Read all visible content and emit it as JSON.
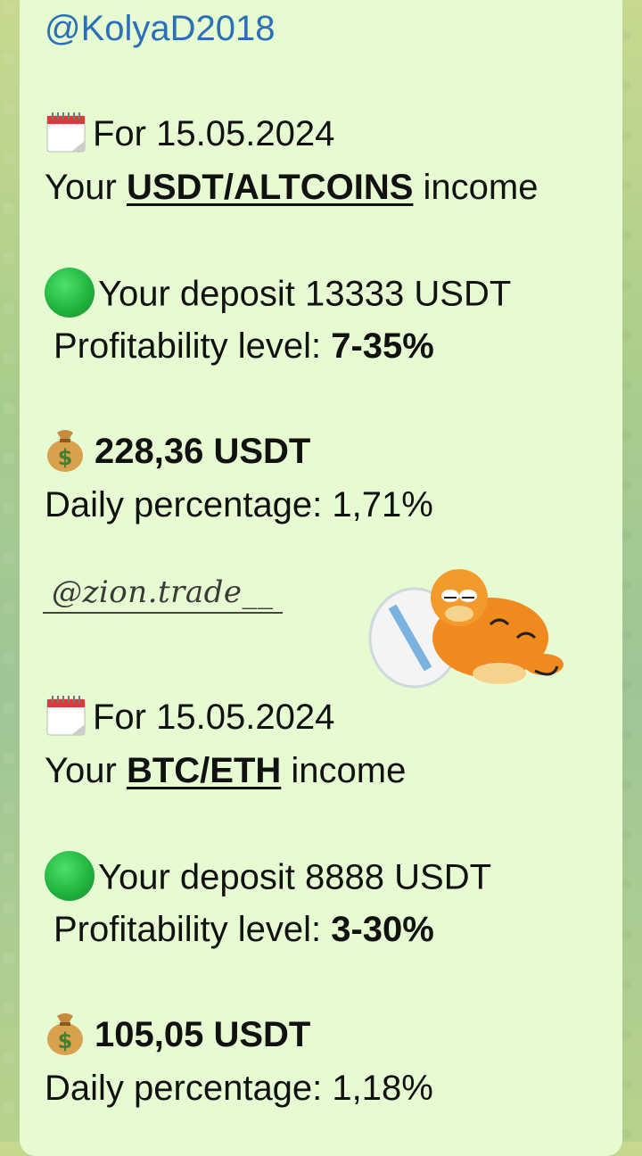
{
  "sender": "@KolyaD2018",
  "block1": {
    "date_line": "For 15.05.2024",
    "income_prefix": "Your ",
    "pair": "USDT/ALTCOINS",
    "income_suffix": " income",
    "deposit": "Your deposit 13333 USDT",
    "profit_label": "Profitability level: ",
    "profit_value": "7-35%",
    "amount": "228,36 USDT",
    "daily": "Daily percentage: 1,71%"
  },
  "watermark": "@zion.trade__",
  "block2": {
    "date_line": "For 15.05.2024",
    "income_prefix": "Your ",
    "pair": "BTC/ETH",
    "income_suffix": " income",
    "deposit": "Your deposit 8888 USDT",
    "profit_label": "Profitability level: ",
    "profit_value": "3-30%",
    "amount": "105,05 USDT",
    "daily": "Daily percentage: 1,18%"
  },
  "colors": {
    "bubble": "#e6fbd1",
    "link": "#2a6fb8",
    "text": "#111111"
  }
}
